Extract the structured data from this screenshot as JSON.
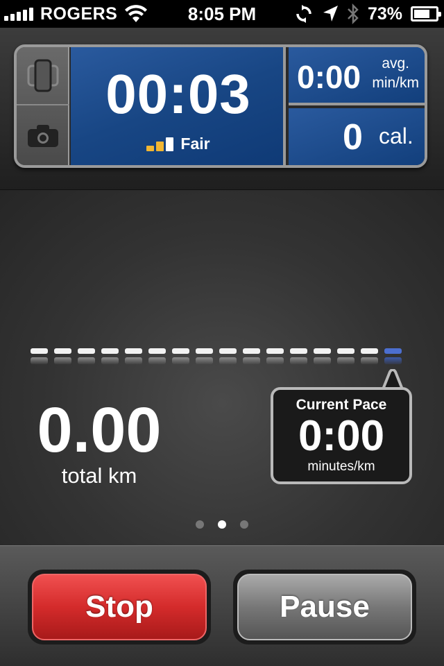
{
  "status_bar": {
    "carrier": "ROGERS",
    "time": "8:05 PM",
    "battery_percent": "73%",
    "battery_level": 0.73,
    "signal_bars": 5
  },
  "dashboard": {
    "timer": "00:03",
    "gps_signal_label": "Fair",
    "gps_signal_colors": [
      "#f2b632",
      "#f2b632",
      "#ffffff"
    ],
    "avg_pace_value": "0:00",
    "avg_pace_unit_line1": "avg.",
    "avg_pace_unit_line2": "min/km",
    "calories_value": "0",
    "calories_unit": "cal.",
    "side_buttons": [
      "phone-lock-icon",
      "camera-icon"
    ]
  },
  "run": {
    "distance_value": "0.00",
    "distance_label": "total km",
    "pace_segments": 16,
    "current_pace_title": "Current Pace",
    "current_pace_value": "0:00",
    "current_pace_unit": "minutes/km",
    "page_dots": 3,
    "active_page": 1
  },
  "controls": {
    "stop_label": "Stop",
    "pause_label": "Pause"
  },
  "colors": {
    "dashboard_blue": "#184684",
    "stop_red": "#d42b2b",
    "pace_active": "#4c6fd0"
  }
}
